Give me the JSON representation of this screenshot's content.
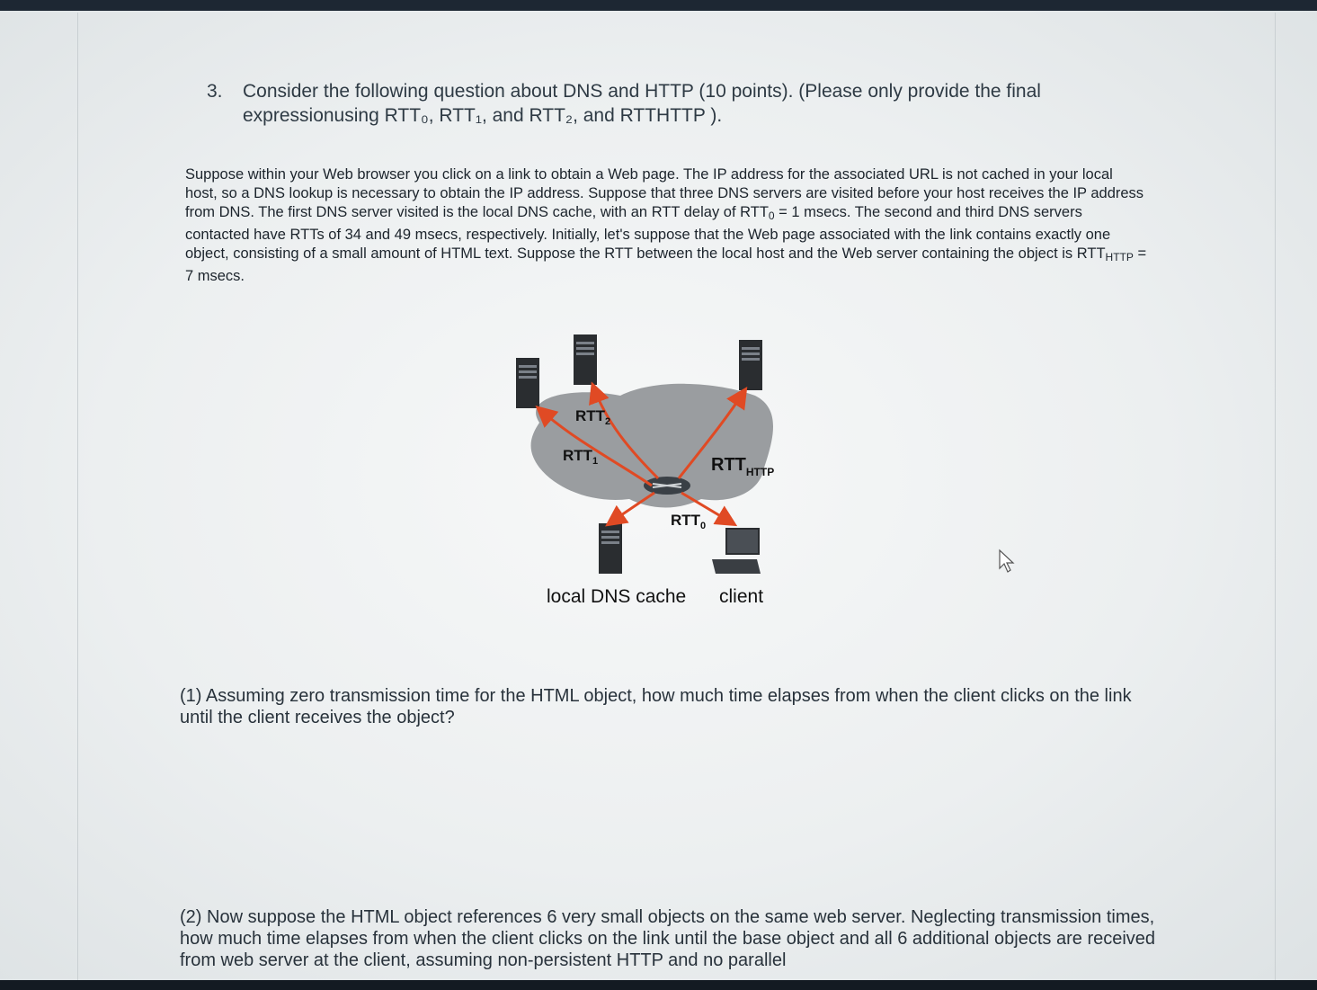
{
  "question": {
    "number": "3.",
    "title_line1": "Consider the following question about DNS and HTTP (10 points). (Please only provide the final",
    "title_line2": "expressionusing RTT₀, RTT₁, and RTT₂, and RTTHTTP ).",
    "body": {
      "part1": "Suppose within your Web browser you click on a link to obtain a Web page. The IP address for the associated URL is not cached in your local host, so a DNS lookup is necessary to obtain the IP address. Suppose that three DNS servers are visited before your host receives the IP address from DNS. The first DNS server visited is the local DNS cache, with an RTT delay of RTT",
      "sub0": "0",
      "part2": " = 1 msecs. The second and third DNS servers contacted have RTTs of 34 and 49 msecs, respectively. Initially, let's suppose that the Web page associated with the link contains exactly one object, consisting of a small amount of HTML text. Suppose the RTT between the local host and the Web server containing the object is RTT",
      "subhttp": "HTTP",
      "part3": " = 7 msecs."
    }
  },
  "diagram": {
    "labels": {
      "rtt2": "RTT",
      "rtt2_sub": "2",
      "rtt1": "RTT",
      "rtt1_sub": "1",
      "rtthttp": "RTT",
      "rtthttp_sub": "HTTP",
      "rtt0": "RTT",
      "rtt0_sub": "0",
      "local_dns": "local DNS cache",
      "client": "client"
    },
    "colors": {
      "arrow": "#e04a24",
      "cloud": "#9a9da0",
      "server": "#2a2d30"
    }
  },
  "parts": {
    "part1": "(1) Assuming zero transmission time for the HTML object, how much time elapses from when the client clicks on the link until the client receives the object?",
    "part2": "(2) Now suppose the HTML object references 6 very small objects on the same web server. Neglecting transmission times, how much time elapses from when the client clicks on the link until the base object and all 6 additional objects are received from web server at the client, assuming non-persistent HTTP and no parallel"
  }
}
